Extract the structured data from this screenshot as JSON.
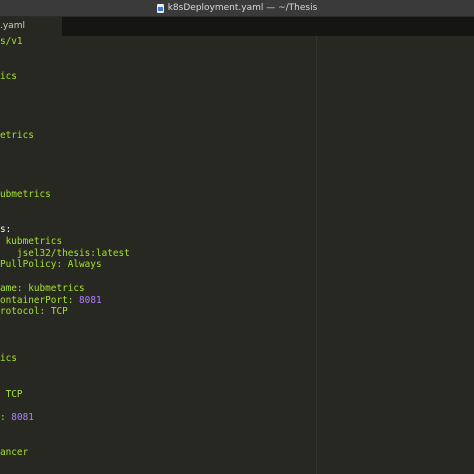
{
  "window": {
    "title": "k8sDeployment.yaml — ~/Thesis",
    "file_icon": "yaml-file-icon"
  },
  "tab": {
    "label": ".yaml"
  },
  "code_lines": [
    [
      {
        "t": "s/v1",
        "c": "g"
      }
    ],
    [
      {
        "t": "",
        "c": "w"
      }
    ],
    [
      {
        "t": "",
        "c": "w"
      }
    ],
    [
      {
        "t": "ics",
        "c": "g"
      }
    ],
    [],
    [],
    [],
    [],
    [
      {
        "t": "etrics",
        "c": "g"
      }
    ],
    [],
    [],
    [],
    [],
    [
      {
        "t": "ubmetrics",
        "c": "g"
      }
    ],
    [],
    [],
    [
      {
        "t": "s:",
        "c": "w"
      }
    ],
    [
      {
        "t": " kubmetrics",
        "c": "g"
      }
    ],
    [
      {
        "t": "   jsel32/thesis:latest",
        "c": "g"
      }
    ],
    [
      {
        "t": "PullPolicy: ",
        "c": "g"
      },
      {
        "t": "Always",
        "c": "g"
      }
    ],
    [],
    [
      {
        "t": "ame: ",
        "c": "g"
      },
      {
        "t": "kubmetrics",
        "c": "g"
      }
    ],
    [
      {
        "t": "ontainerPort: ",
        "c": "g"
      },
      {
        "t": "8081",
        "c": "p"
      }
    ],
    [
      {
        "t": "rotocol: ",
        "c": "g"
      },
      {
        "t": "TCP",
        "c": "g"
      }
    ],
    [],
    [],
    [],
    [
      {
        "t": "ics",
        "c": "g"
      }
    ],
    [],
    [],
    [
      {
        "t": " TCP",
        "c": "g"
      }
    ],
    [
      {
        "t": "",
        "c": "r"
      }
    ],
    [
      {
        "t": ": ",
        "c": "g"
      },
      {
        "t": "8081",
        "c": "p"
      }
    ],
    [],
    [
      {
        "t": "",
        "c": "w"
      }
    ],
    [
      {
        "t": "ancer",
        "c": "g"
      }
    ]
  ]
}
